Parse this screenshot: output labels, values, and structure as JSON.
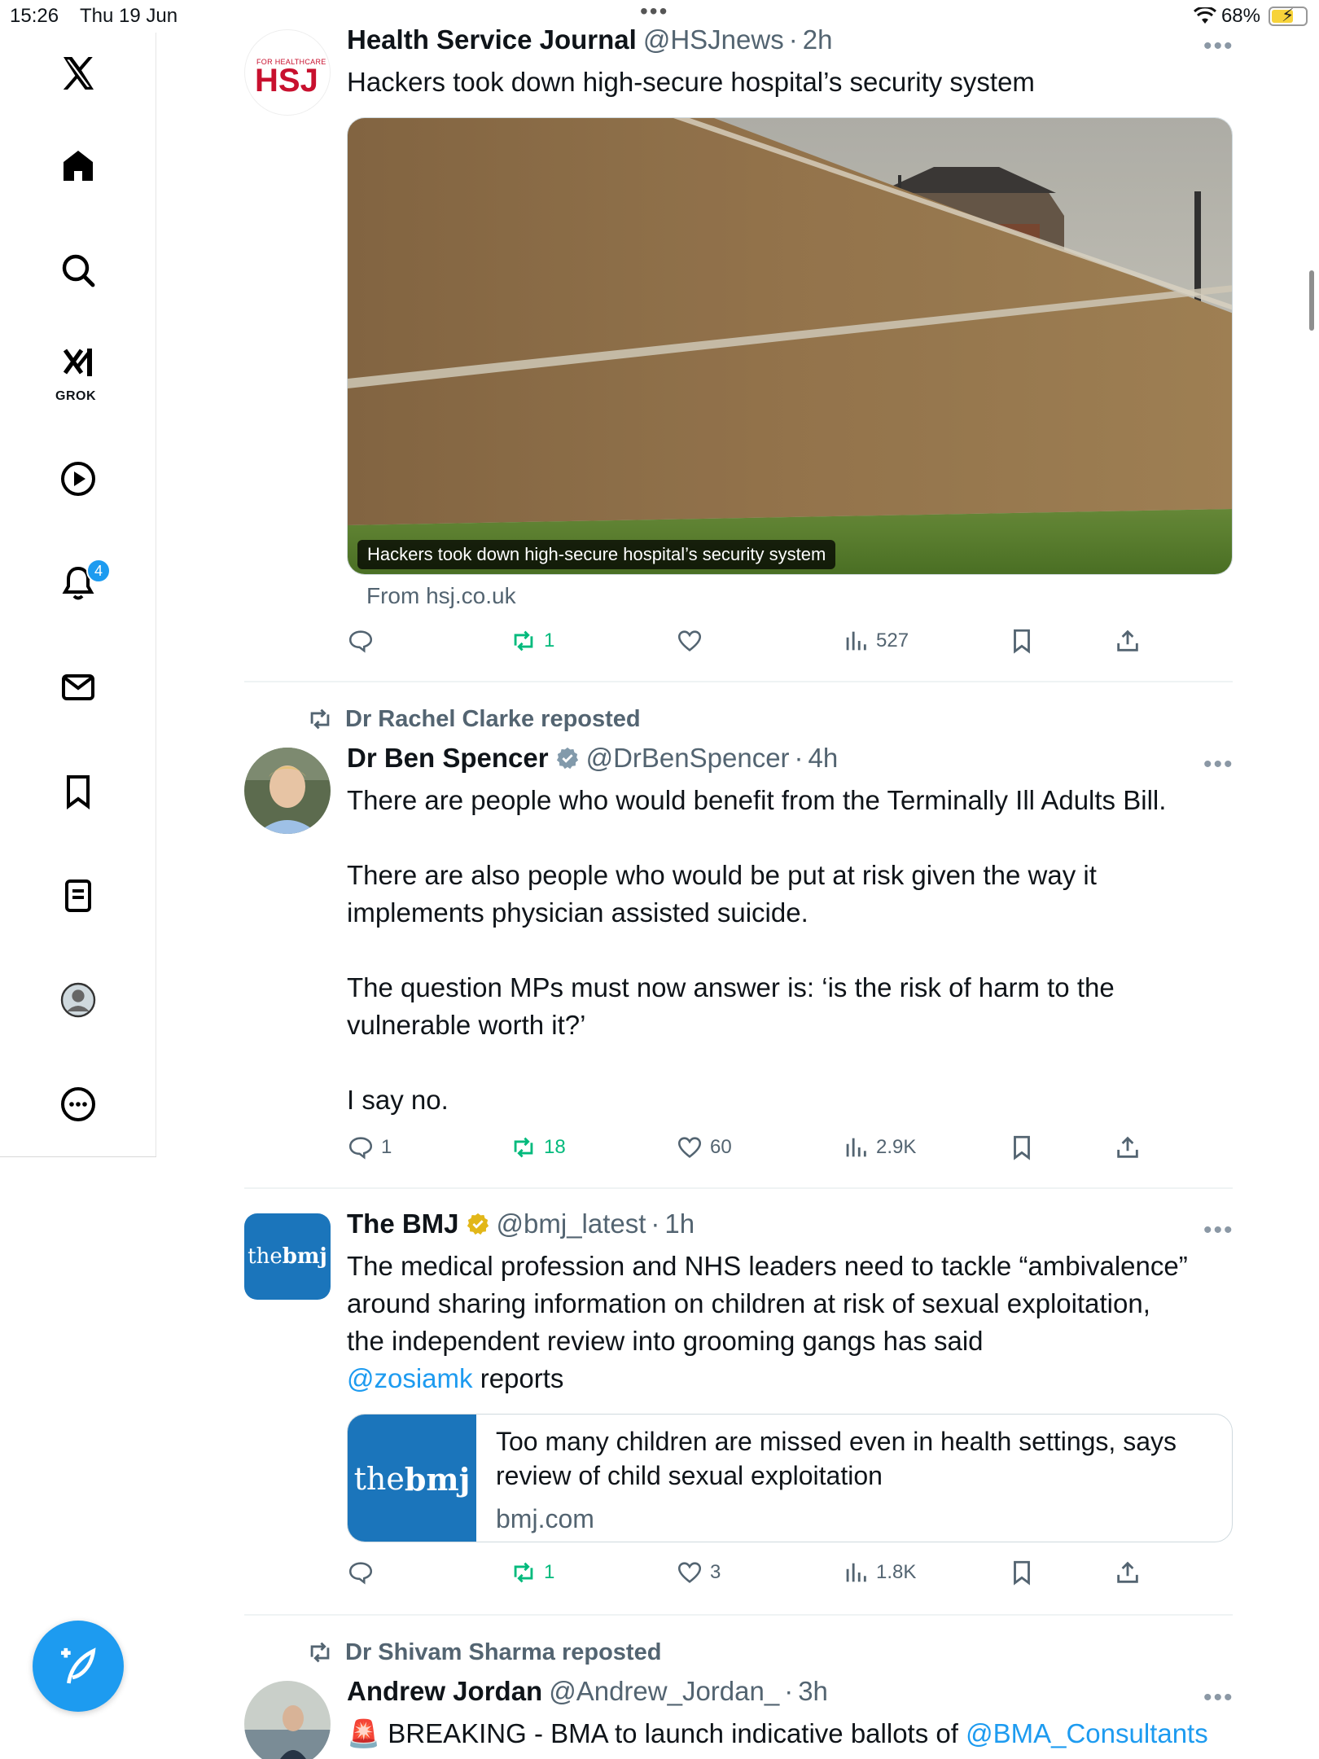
{
  "status_bar": {
    "time": "15:26",
    "date": "Thu 19 Jun",
    "battery": "68%"
  },
  "sidebar": {
    "grok_label": "GROK",
    "notification_count": "4"
  },
  "tweets": [
    {
      "name": "Health Service Journal",
      "handle": "@HSJnews",
      "time": "2h",
      "text": "Hackers took down high-secure hospital’s security system",
      "avatar_text": "HSJ",
      "avatar_small": "FOR HEALTHCARE LEADERS",
      "media_caption": "Hackers took down high-secure hospital’s security system",
      "from": "From hsj.co.uk",
      "replies": "",
      "reposts": "1",
      "likes": "",
      "views": "527"
    },
    {
      "repost_by": "Dr Rachel Clarke reposted",
      "name": "Dr Ben Spencer",
      "handle": "@DrBenSpencer",
      "time": "4h",
      "text": "There are people who would benefit from the Terminally Ill Adults Bill.\n\nThere are also people who would be put at risk given the way it\nimplements physician assisted suicide.\n\nThe question MPs must now answer is: ‘is the risk of harm to the\nvulnerable worth it?’\n\nI say no.",
      "replies": "1",
      "reposts": "18",
      "likes": "60",
      "views": "2.9K"
    },
    {
      "name": "The BMJ",
      "handle": "@bmj_latest",
      "time": "1h",
      "text": "The medical profession and NHS leaders need to tackle “ambivalence”\naround sharing information on children at risk of sexual exploitation,\nthe independent review into grooming gangs has said",
      "mention": "@zosiamk",
      "mention_suffix": " reports",
      "avatar_text_a": "the",
      "avatar_text_b": "bmj",
      "card_title": "Too many children are missed even in health settings, says review of child sexual exploitation",
      "card_domain": "bmj.com",
      "replies": "",
      "reposts": "1",
      "likes": "3",
      "views": "1.8K"
    },
    {
      "repost_by": "Dr Shivam Sharma reposted",
      "name": "Andrew Jordan",
      "handle": "@Andrew_Jordan_",
      "time": "3h",
      "text_prefix": "🚨 BREAKING - BMA to launch indicative ballots of ",
      "mention": "@BMA_Consultants"
    }
  ]
}
